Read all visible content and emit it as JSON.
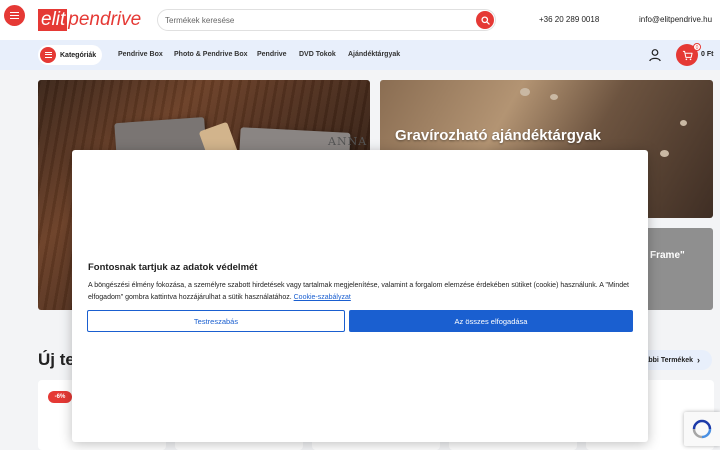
{
  "header": {
    "logo_elit": "elit",
    "logo_pendrive": "pendrive",
    "search_placeholder": "Termékek keresése",
    "phone": "+36 20 289 0018",
    "email": "info@elitpendrive.hu"
  },
  "nav": {
    "categories_label": "Kategóriák",
    "items": [
      "Pendrive Box",
      "Photo & Pendrive Box",
      "Pendrive",
      "DVD Tokok",
      "Ajándéktárgyak"
    ],
    "cart_count": "0",
    "cart_total": "0 Ft"
  },
  "banners": {
    "left_engraving": "ANNA",
    "right_top_title": "Gravírozható ajándéktárgyak",
    "right_bottom_title": "Frame\""
  },
  "products": {
    "section_title": "Új termékek",
    "more_label": "További Termékek",
    "discount_badge": "-6%"
  },
  "cookie": {
    "title": "Fontosnak tartjuk az adatok védelmét",
    "text": "A böngészési élmény fokozása, a személyre szabott hirdetések vagy tartalmak megjelenítése, valamint a forgalom elemzése érdekében sütiket (cookie) használunk. A \"Mindet elfogadom\" gombra kattintva hozzájárulhat a sütik használatához.",
    "link_label": "Cookie-szabályzat",
    "customize_label": "Testreszabás",
    "accept_label": "Az összes elfogadása"
  },
  "colors": {
    "brand_red": "#e53935",
    "accent_blue": "#1a5fd0",
    "nav_bg": "#e8effb"
  },
  "icons": [
    "menu-icon",
    "search-icon",
    "user-icon",
    "cart-icon",
    "chevron-right-icon",
    "recaptcha-icon"
  ]
}
